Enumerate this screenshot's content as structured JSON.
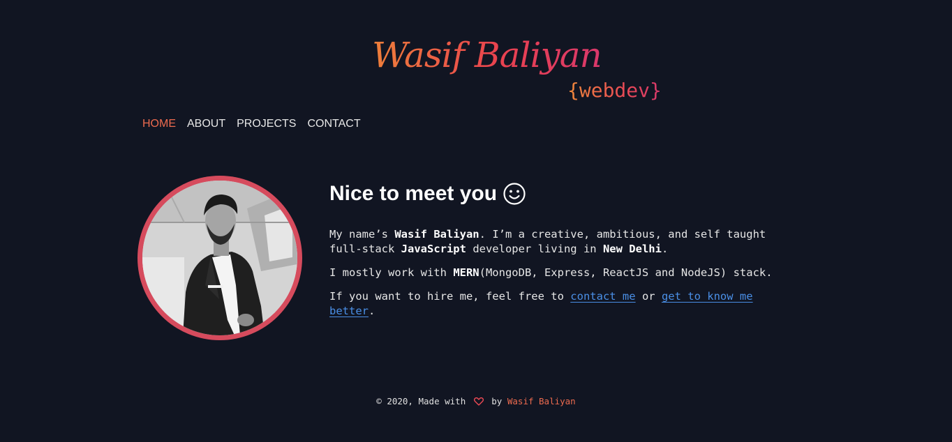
{
  "header": {
    "logo_name": "Wasif Baliyan",
    "logo_tag": "{webdev}",
    "gradient_start": "#ee7f3a",
    "gradient_end": "#d9386b"
  },
  "nav": {
    "items": [
      {
        "label": "HOME",
        "active": true
      },
      {
        "label": "ABOUT",
        "active": false
      },
      {
        "label": "PROJECTS",
        "active": false
      },
      {
        "label": "CONTACT",
        "active": false
      }
    ],
    "active_color": "#ee6b4f"
  },
  "hero": {
    "avatar_icon": "profile-photo",
    "ring_color": "#d64b5d",
    "heading": "Nice to meet you",
    "heading_icon": "smiley-face-icon",
    "p1": {
      "t1": "My name’s ",
      "name": "Wasif Baliyan",
      "t2": ". I’m a creative, ambitious, and self taught full-stack ",
      "lang": "JavaScript",
      "t3": " developer living in ",
      "city": "New Delhi",
      "t4": "."
    },
    "p2": {
      "t1": "I mostly work with ",
      "stack": "MERN",
      "t2": "(MongoDB, Express, ReactJS and NodeJS) stack."
    },
    "p3": {
      "t1": "If you want to hire me, feel free to ",
      "link1": "contact me",
      "t2": " or ",
      "link2": "get to know me better",
      "t3": "."
    },
    "link_color": "#4a8fe6"
  },
  "footer": {
    "copyright": "© 2020, Made with",
    "heart_icon": "heart-icon",
    "by": "by",
    "author": "Wasif Baliyan"
  }
}
